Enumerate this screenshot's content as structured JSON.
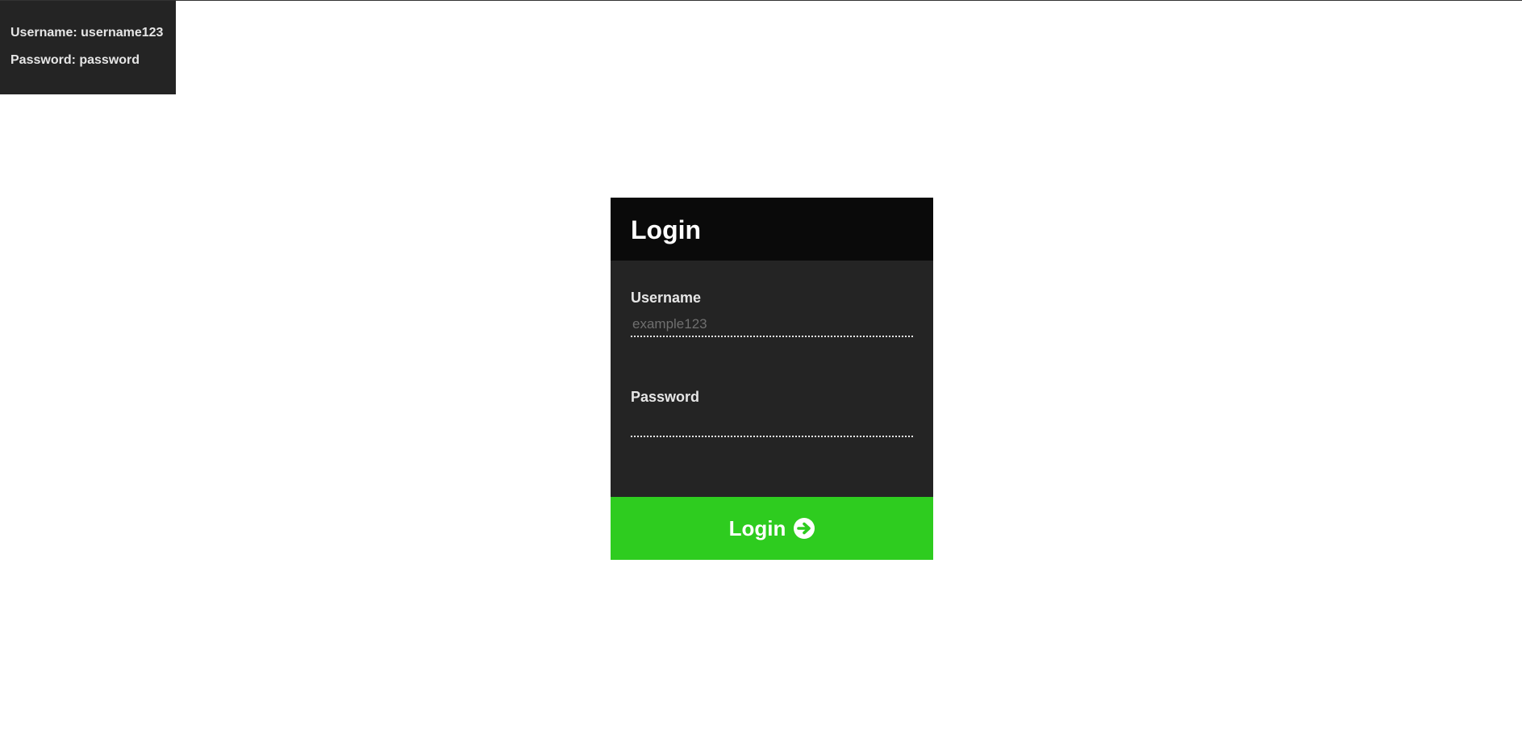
{
  "hint": {
    "username_line": "Username: username123",
    "password_line": "Password: password"
  },
  "login": {
    "title": "Login",
    "username_label": "Username",
    "username_placeholder": "example123",
    "username_value": "",
    "password_label": "Password",
    "password_placeholder": "",
    "password_value": "",
    "button_label": "Login",
    "button_icon": "arrow-circle-right-icon"
  },
  "colors": {
    "hint_background": "#242424",
    "card_header": "#0a0a0a",
    "card_body": "#242424",
    "button_accent": "#2ecc1f",
    "text_light": "#e6e6e6"
  }
}
